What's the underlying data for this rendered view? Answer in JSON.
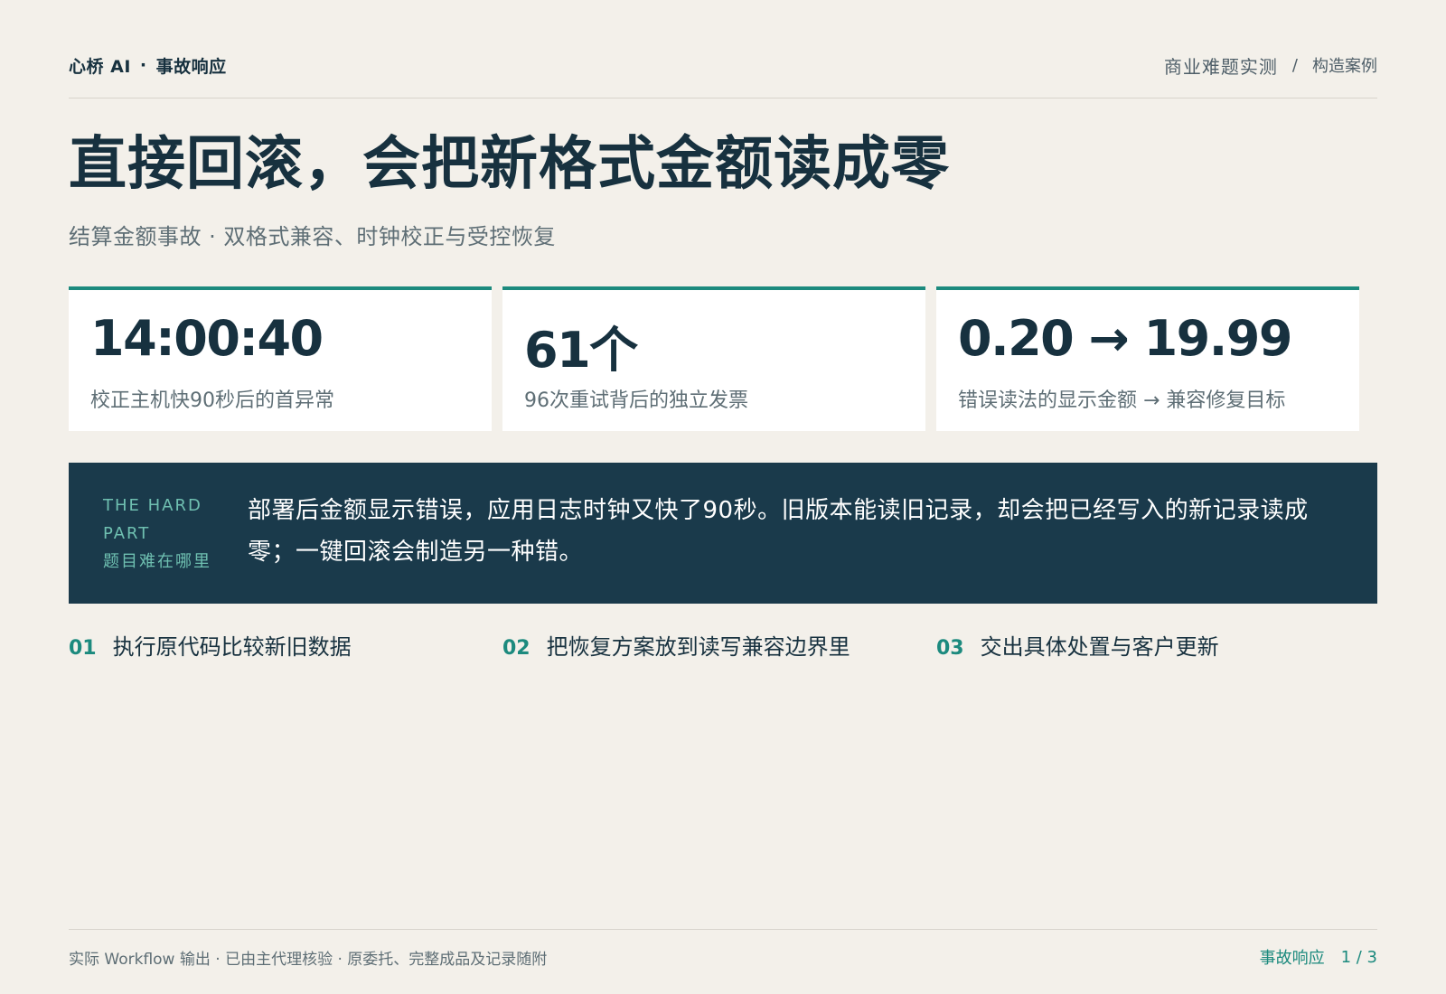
{
  "header": {
    "brand": "心桥 AI",
    "brand_separator": "·",
    "section": "事故响应",
    "breadcrumb_main": "商业难题实测",
    "breadcrumb_separator": "/",
    "breadcrumb_sub": "构造案例"
  },
  "title": "直接回滚，会把新格式金额读成零",
  "subtitle": "结算金额事故 · 双格式兼容、时钟校正与受控恢复",
  "stats": [
    {
      "value": "14:00:40",
      "label": "校正主机快90秒后的首异常"
    },
    {
      "value": "61个",
      "label": "96次重试背后的独立发票"
    },
    {
      "value": "0.20 → 19.99",
      "label": "错误读法的显示金额 → 兼容修复目标"
    }
  ],
  "hard_part": {
    "tag_en": "THE HARD PART",
    "tag_cn": "题目难在哪里",
    "text": "部署后金额显示错误，应用日志时钟又快了90秒。旧版本能读旧记录，却会把已经写入的新记录读成零；一键回滚会制造另一种错。"
  },
  "steps": [
    {
      "num": "01",
      "text": "执行原代码比较新旧数据"
    },
    {
      "num": "02",
      "text": "把恢复方案放到读写兼容边界里"
    },
    {
      "num": "03",
      "text": "交出具体处置与客户更新"
    }
  ],
  "footer": {
    "note": "实际 Workflow 输出 · 已由主代理核验 · 原委托、完整成品及记录随附",
    "section": "事故响应",
    "page": "1 / 3"
  },
  "colors": {
    "background": "#f3f0ea",
    "ink": "#17313f",
    "accent": "#1c8a7e",
    "banner": "#1a3a4b",
    "banner_tag": "#6fc0b1"
  }
}
